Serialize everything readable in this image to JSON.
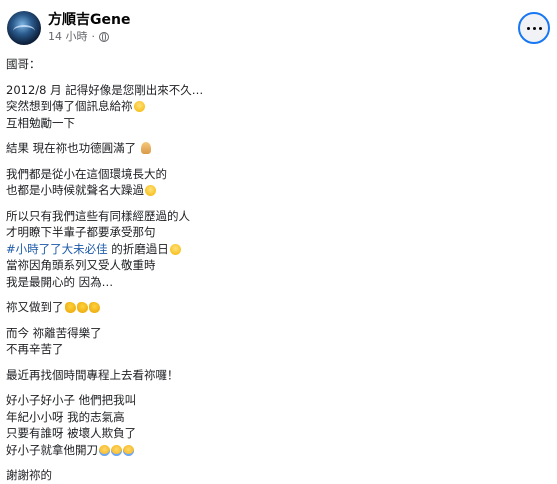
{
  "post": {
    "author": "方順吉Gene",
    "timestamp": "14 小時",
    "separator": "·",
    "privacy_icon": "globe-icon",
    "more_icon": "more-horizontal-icon",
    "accent_color": "#1877f2"
  },
  "content": {
    "greeting": "國哥：",
    "l1": "2012/8 月 記得好像是您剛出來不久…",
    "l2": "突然想到傳了個訊息給祢",
    "l3": "互相勉勵一下",
    "l4": "結果 現在祢也功德圓滿了",
    "l5": "我們都是從小在這個環境長大的",
    "l6": "也都是小時候就聲名大躁過",
    "l7": "所以只有我們這些有同樣經歷過的人",
    "l8": "才明瞭下半輩子都要承受那句",
    "hashtag": "#小時了了大未必佳",
    "l9_suffix": " 的折磨過日",
    "l10": "當祢因角頭系列又受人敬重時",
    "l11": "我是最開心的 因為…",
    "l12": "祢又做到了",
    "l13": "而今 祢離苦得樂了",
    "l14": "不再辛苦了",
    "l15": "最近再找個時間專程上去看祢囉！",
    "l16": "好小子好小子 他們把我叫",
    "l17": "年紀小小呀 我的志氣高",
    "l18": "只要有誰呀 被壞人欺負了",
    "l19": "好小子就拿他開刀",
    "l20": "謝謝祢的"
  },
  "emoji_names": {
    "smile": "smiling-face-emoji",
    "pray": "folded-hands-emoji",
    "clap": "clapping-hands-emoji",
    "cry": "crying-face-emoji"
  }
}
